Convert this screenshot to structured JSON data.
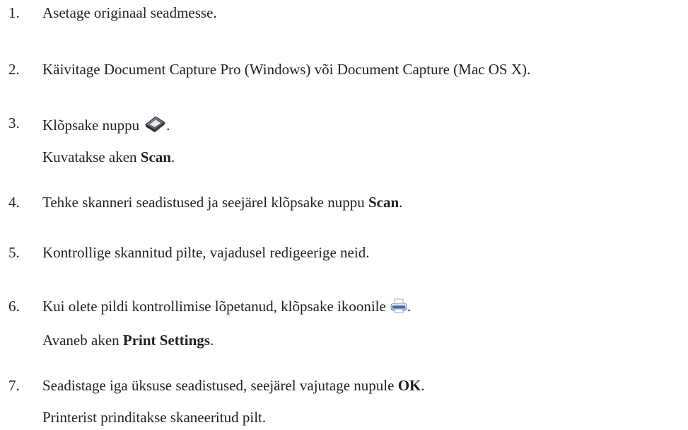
{
  "steps": [
    {
      "number": "1.",
      "text": "Asetage originaal seadmesse."
    },
    {
      "number": "2.",
      "text": "Käivitage Document Capture Pro (Windows) või Document Capture (Mac OS X)."
    },
    {
      "number": "3.",
      "text": "Klõpsake nuppu",
      "icon": "scan-icon",
      "text_after": ".",
      "sub": {
        "before": "Kuvatakse aken ",
        "bold": "Scan",
        "after": "."
      }
    },
    {
      "number": "4.",
      "text": "Tehke skanneri seadistused ja seejärel klõpsake nuppu ",
      "bold": "Scan",
      "after": "."
    },
    {
      "number": "5.",
      "text": "Kontrollige skannitud pilte, vajadusel redigeerige neid."
    },
    {
      "number": "6.",
      "text": "Kui olete pildi kontrollimise lõpetanud, klõpsake ikoonile",
      "icon": "printer-icon",
      "text_after": ".",
      "sub": {
        "before": "Avaneb aken ",
        "bold": "Print Settings",
        "after": "."
      }
    },
    {
      "number": "7.",
      "text": "Seadistage iga üksuse seadistused, seejärel vajutage nupule ",
      "bold": "OK",
      "after": ".",
      "sub_plain": "Printerist prinditakse skaneeritud pilt."
    }
  ]
}
